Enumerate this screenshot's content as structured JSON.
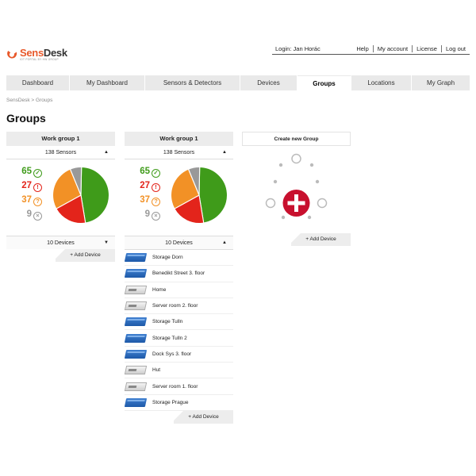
{
  "logo": {
    "brand_a": "Sens",
    "brand_b": "Desk",
    "tagline": "IOT PORTAL BY HW GROUP"
  },
  "header": {
    "login": "Login: Jan Horác",
    "links": [
      "Help",
      "My account",
      "License",
      "Log out"
    ]
  },
  "nav": {
    "tabs": [
      {
        "label": "Dashboard",
        "w": 80
      },
      {
        "label": "My Dashboard",
        "w": 95
      },
      {
        "label": "Sensors & Detectors",
        "w": 120
      },
      {
        "label": "Devices",
        "w": 72
      },
      {
        "label": "Groups",
        "w": 68,
        "active": true
      },
      {
        "label": "Locations",
        "w": 76
      },
      {
        "label": "My Graph",
        "w": 73
      }
    ]
  },
  "breadcrumb": "SensDesk  >  Groups",
  "page_title": "Groups",
  "groups": [
    {
      "name": "Work group 1",
      "sensors_label": "138 Sensors",
      "stats": {
        "ok": "65",
        "alarm": "27",
        "warn": "37",
        "off": "9"
      },
      "devices_label": "10 Devices",
      "devices_caret": "▼",
      "add_device": "+ Add Device"
    },
    {
      "name": "Work group 1",
      "sensors_label": "138 Sensors",
      "stats": {
        "ok": "65",
        "alarm": "27",
        "warn": "37",
        "off": "9"
      },
      "devices_label": "10 Devices",
      "devices_caret": "▲",
      "add_device": "+ Add Device",
      "devices": [
        {
          "name": "Storage Dorn",
          "type": "blue"
        },
        {
          "name": "Benedikt Street 3. floor",
          "type": "blue"
        },
        {
          "name": "Home",
          "type": "white"
        },
        {
          "name": "Server room 2. floor",
          "type": "white"
        },
        {
          "name": "Storage Tulln",
          "type": "blue"
        },
        {
          "name": "Storage Tulln 2",
          "type": "blue"
        },
        {
          "name": "Dock Sys 3. floor",
          "type": "blue"
        },
        {
          "name": "Hut",
          "type": "white"
        },
        {
          "name": "Server room 1. floor",
          "type": "white"
        },
        {
          "name": "Storage Prague",
          "type": "blue"
        }
      ]
    }
  ],
  "create_group": {
    "title": "Create new Group",
    "add_device": "+ Add Device"
  },
  "icons": {
    "ok": "check-circle-icon",
    "alarm": "exclamation-circle-icon",
    "warn": "question-circle-icon",
    "off": "x-circle-icon"
  },
  "colors": {
    "ok": "#3f9b1a",
    "alarm": "#e3241b",
    "warn": "#f29126",
    "off": "#999999",
    "brand": "#e8592b",
    "create": "#c8102e"
  }
}
